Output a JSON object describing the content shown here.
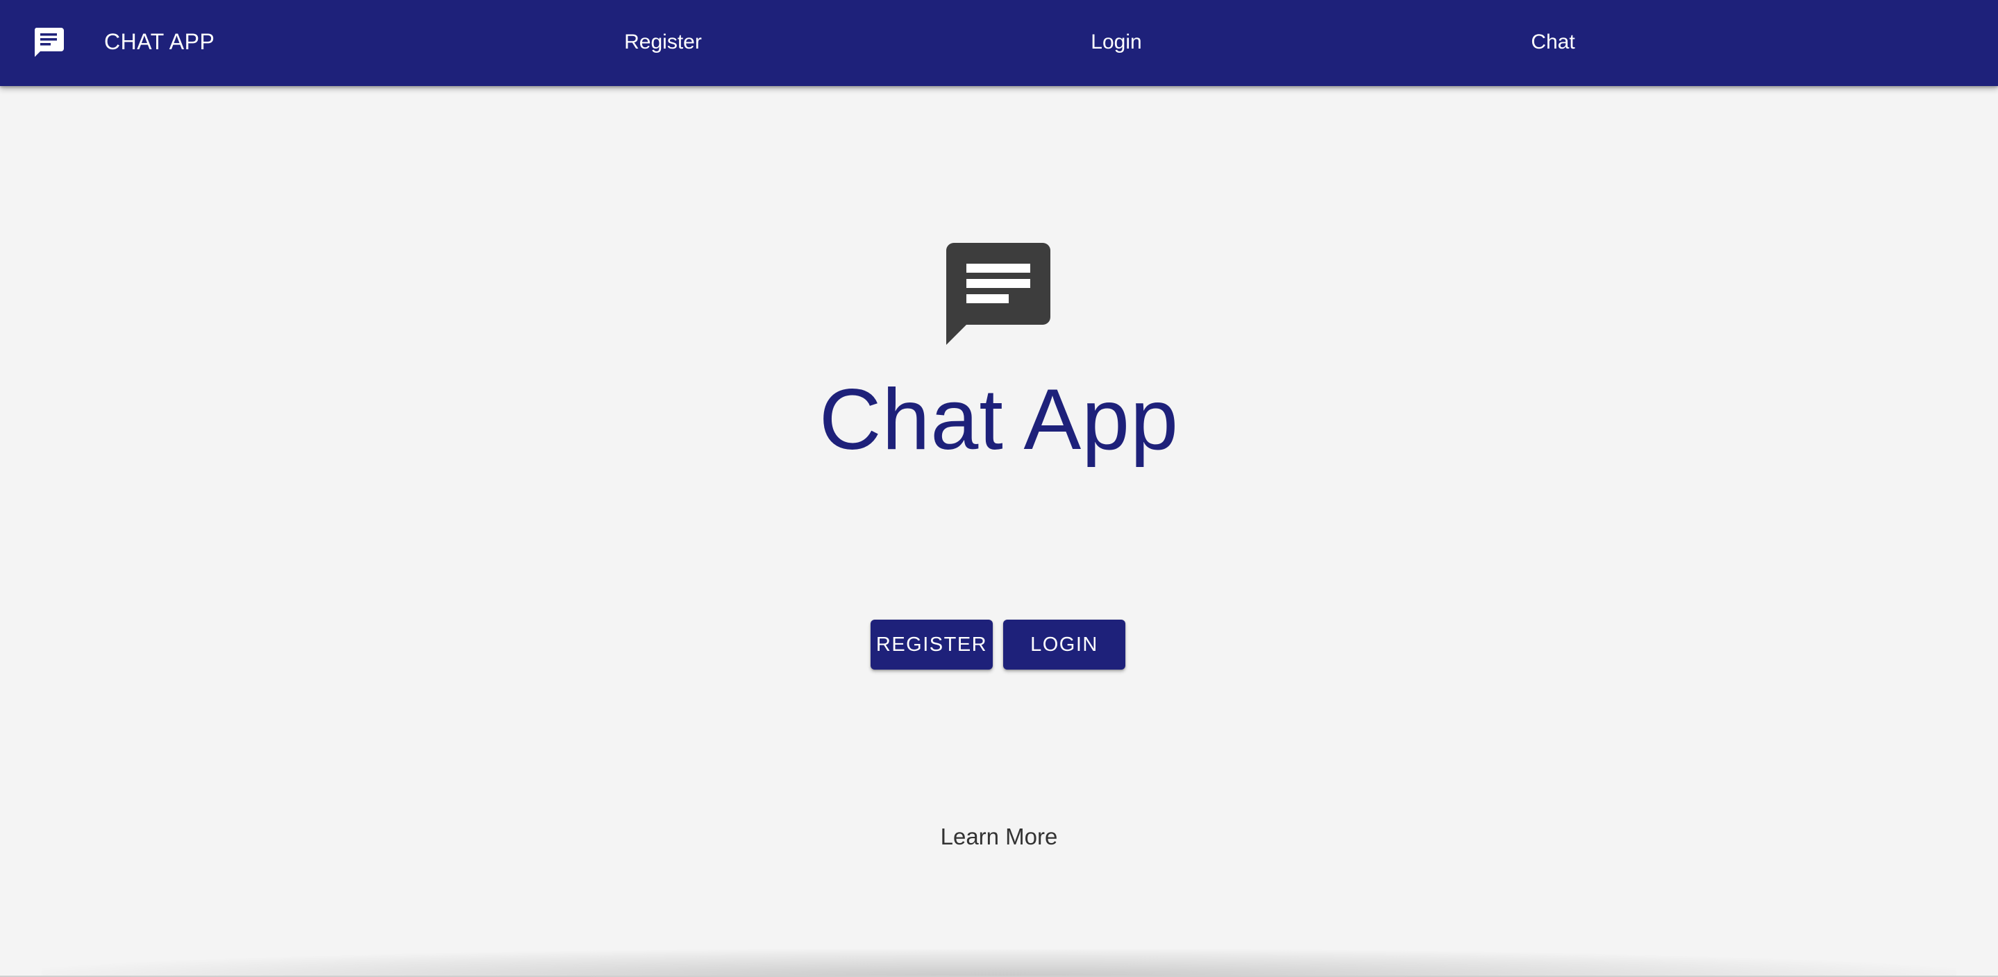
{
  "appbar": {
    "logo_icon": "chat-bubble-icon",
    "brand": "CHAT APP",
    "nav": [
      {
        "label": "Register"
      },
      {
        "label": "Login"
      },
      {
        "label": "Chat"
      }
    ],
    "background_color": "#1e217a"
  },
  "hero": {
    "icon": "chat-bubble-icon",
    "title": "Chat App",
    "title_color": "#1e217a"
  },
  "actions": {
    "register_label": "REGISTER",
    "login_label": "LOGIN"
  },
  "learn_more": "Learn More"
}
